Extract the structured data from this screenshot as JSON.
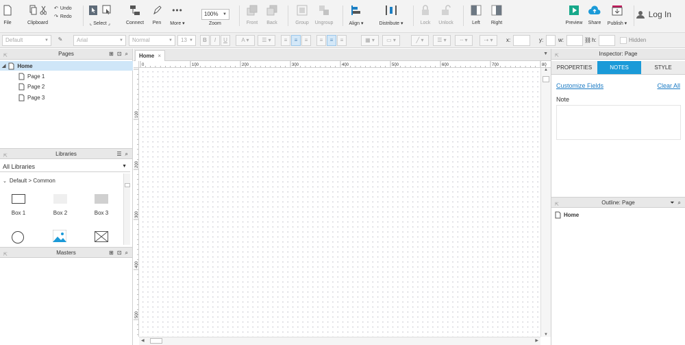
{
  "toolbar": {
    "file": "File",
    "clipboard": "Clipboard",
    "undo": "Undo",
    "redo": "Redo",
    "select": "Select",
    "connect": "Connect",
    "pen": "Pen",
    "more": "More ▾",
    "zoom_value": "100%",
    "zoom": "Zoom",
    "front": "Front",
    "back": "Back",
    "group": "Group",
    "ungroup": "Ungroup",
    "align": "Align ▾",
    "distribute": "Distribute ▾",
    "lock": "Lock",
    "unlock": "Unlock",
    "left": "Left",
    "right": "Right",
    "preview": "Preview",
    "share": "Share",
    "publish": "Publish ▾",
    "login": "Log In"
  },
  "format": {
    "style": "Default",
    "font": "Arial",
    "weight": "Normal",
    "size": "13",
    "x_label": "x:",
    "y_label": "y:",
    "w_label": "w:",
    "h_label": "h:",
    "hidden": "Hidden"
  },
  "pages": {
    "title": "Pages",
    "home": "Home",
    "items": [
      "Page 1",
      "Page 2",
      "Page 3"
    ]
  },
  "libraries": {
    "title": "Libraries",
    "selected": "All Libraries",
    "group": "Default > Common",
    "widgets": [
      "Box 1",
      "Box 2",
      "Box 3"
    ]
  },
  "masters": {
    "title": "Masters"
  },
  "canvas": {
    "tab": "Home",
    "ruler_h": [
      "0",
      "100",
      "200",
      "300",
      "400",
      "500",
      "600",
      "700",
      "80"
    ],
    "ruler_v": [
      "100",
      "200",
      "300",
      "400",
      "500"
    ]
  },
  "inspector": {
    "title": "Inspector: Page",
    "tabs": [
      "PROPERTIES",
      "NOTES",
      "STYLE"
    ],
    "customize": "Customize Fields",
    "clear": "Clear All",
    "note": "Note"
  },
  "outline": {
    "title": "Outline: Page",
    "home": "Home"
  },
  "colors": {
    "accent": "#1b9ad8",
    "selected_row": "#cfe6f8",
    "link": "#1a7ac4"
  }
}
